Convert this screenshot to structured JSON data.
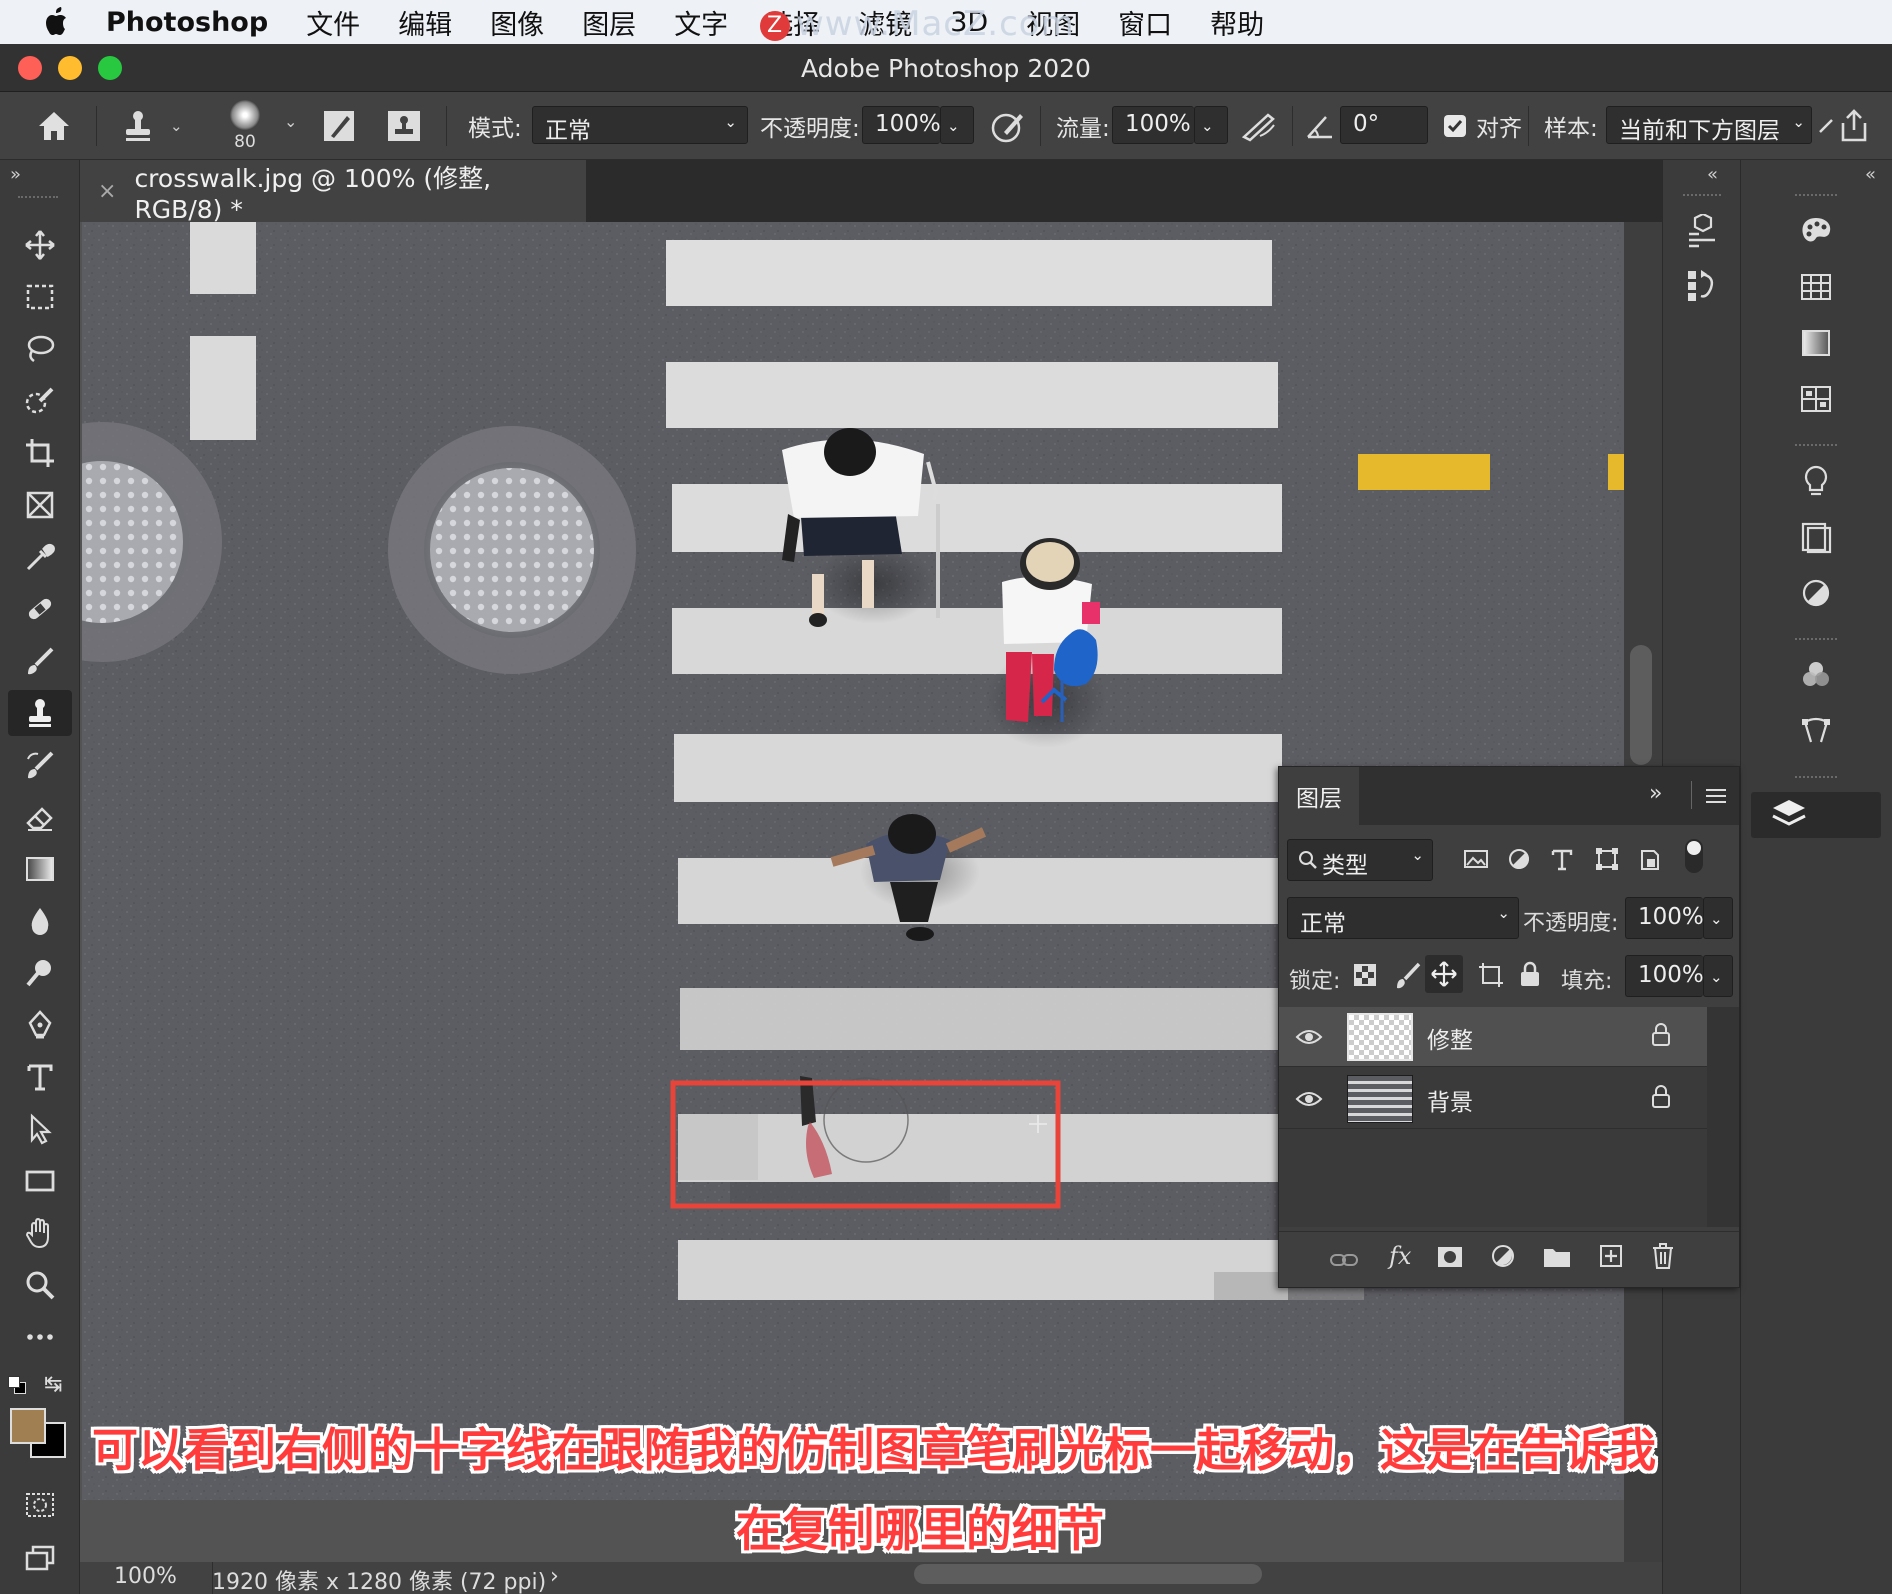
{
  "menubar": {
    "app_name": "Photoshop",
    "items": [
      "文件",
      "编辑",
      "图像",
      "图层",
      "文字",
      "选择",
      "滤镜",
      "3D",
      "视图",
      "窗口",
      "帮助"
    ],
    "watermark": "www.MacZ.com"
  },
  "window": {
    "title": "Adobe Photoshop 2020"
  },
  "options_bar": {
    "brush_size": "80",
    "mode_label": "模式:",
    "mode_value": "正常",
    "opacity_label": "不透明度:",
    "opacity_value": "100%",
    "flow_label": "流量:",
    "flow_value": "100%",
    "angle_value": "0°",
    "aligned_label": "对齐",
    "aligned_checked": true,
    "sample_label": "样本:",
    "sample_value": "当前和下方图层"
  },
  "document": {
    "tab_title": "crosswalk.jpg @ 100% (修整, RGB/8) *",
    "zoom": "100%",
    "info": "1920 像素 x 1280 像素 (72 ppi)"
  },
  "toolbar": {
    "tools": [
      "move",
      "marquee",
      "lasso",
      "quick-select",
      "crop",
      "frame",
      "eyedropper",
      "healing-brush",
      "brush",
      "clone-stamp",
      "history-brush",
      "eraser",
      "gradient",
      "blur",
      "dodge",
      "pen",
      "type",
      "path-select",
      "rectangle",
      "hand",
      "zoom",
      "more"
    ],
    "selected_tool": "clone-stamp",
    "foreground_color": "#a08052",
    "background_color": "#000000"
  },
  "layers_panel": {
    "tab_label": "图层",
    "filter_value": "类型",
    "blend_mode": "正常",
    "opacity_label": "不透明度:",
    "opacity_value": "100%",
    "lock_label": "锁定:",
    "fill_label": "填充:",
    "fill_value": "100%",
    "layers": [
      {
        "name": "修整",
        "visible": true,
        "locked": true,
        "selected": true
      },
      {
        "name": "背景",
        "visible": true,
        "locked": true,
        "selected": false
      }
    ]
  },
  "subtitles": {
    "line1": "可以看到右侧的十字线在跟随我的仿制图章笔刷光标一起移动，这是在告诉我",
    "line2": "在复制哪里的细节"
  },
  "colors": {
    "highlight_box": "#e8443a",
    "subtitle_text": "#ff3b3b",
    "crosswalk_stripe": "#dadada",
    "asphalt": "#5c5d63",
    "road_marking_yellow": "#e6b92c"
  }
}
